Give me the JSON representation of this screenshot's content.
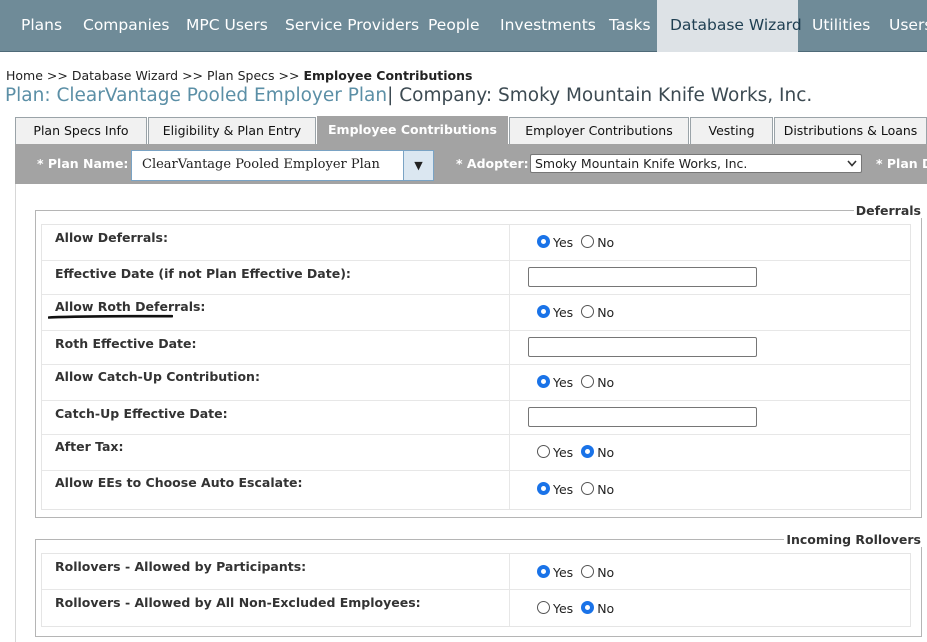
{
  "topnav": {
    "items": [
      {
        "label": "Plans"
      },
      {
        "label": "Companies"
      },
      {
        "label": "MPC Users"
      },
      {
        "label": "Service Providers"
      },
      {
        "label": "People"
      },
      {
        "label": "Investments"
      },
      {
        "label": "Tasks"
      },
      {
        "label": "Database Wizard",
        "active": true
      },
      {
        "label": "Utilities"
      },
      {
        "label": "Users"
      }
    ]
  },
  "breadcrumb": {
    "home": "Home",
    "sep": ">>",
    "db": "Database Wizard",
    "specs": "Plan Specs",
    "current": "Employee Contributions"
  },
  "heading": {
    "plan": "Plan: ClearVantage Pooled Employer Plan",
    "company": "| Company: Smoky Mountain Knife Works, Inc."
  },
  "tabs": [
    {
      "label": "Plan Specs Info"
    },
    {
      "label": "Eligibility & Plan Entry"
    },
    {
      "label": "Employee Contributions",
      "active": true
    },
    {
      "label": "Employer Contributions"
    },
    {
      "label": "Vesting"
    },
    {
      "label": "Distributions & Loans"
    }
  ],
  "filters": {
    "plan_name_label": "* Plan Name:",
    "plan_name_value": "ClearVantage Pooled Employer Plan",
    "adopter_label": "* Adopter:",
    "adopter_value": "Smoky Mountain Knife Works, Inc.",
    "plan_d_label": "* Plan D"
  },
  "radio_labels": {
    "yes": "Yes",
    "no": "No"
  },
  "deferrals": {
    "legend": "Deferrals",
    "rows": [
      {
        "label": "Allow Deferrals:",
        "type": "radio",
        "value": "Yes"
      },
      {
        "label": "Effective Date (if not Plan Effective Date):",
        "type": "text",
        "value": ""
      },
      {
        "label": "Allow Roth Deferrals:",
        "type": "radio",
        "value": "Yes"
      },
      {
        "label": "Roth Effective Date:",
        "type": "text",
        "value": ""
      },
      {
        "label": "Allow Catch-Up Contribution:",
        "type": "radio",
        "value": "Yes"
      },
      {
        "label": "Catch-Up Effective Date:",
        "type": "text",
        "value": ""
      },
      {
        "label": "After Tax:",
        "type": "radio",
        "value": "No"
      },
      {
        "label": "Allow EEs to Choose Auto Escalate:",
        "type": "radio",
        "value": "Yes"
      }
    ]
  },
  "rollovers": {
    "legend": "Incoming Rollovers",
    "rows": [
      {
        "label": "Rollovers - Allowed by Participants:",
        "type": "radio",
        "value": "Yes"
      },
      {
        "label": "Rollovers - Allowed by All Non-Excluded Employees:",
        "type": "radio",
        "value": "No"
      }
    ]
  },
  "colors": {
    "nav_bg": "#6f8b98",
    "nav_active_bg": "#dde2e6",
    "tab_active_bg": "#a3a3a3",
    "plan_text": "#5b8fa6",
    "radio_checked": "#1a73e8"
  }
}
